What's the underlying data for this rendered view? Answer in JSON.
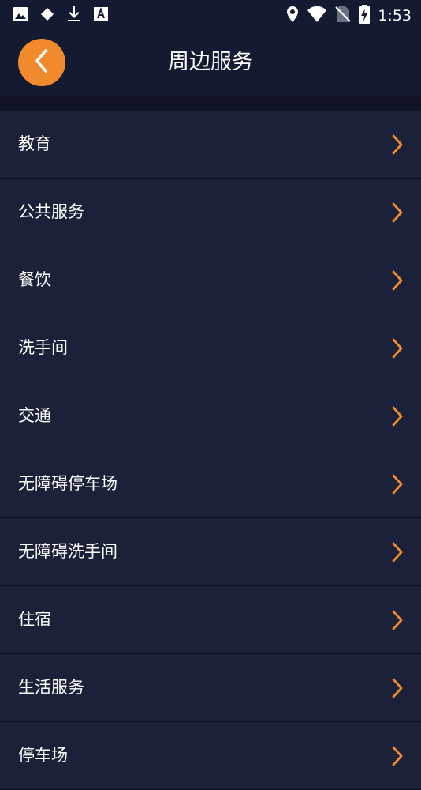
{
  "status_bar": {
    "time": "1:53",
    "icons": [
      "image-icon",
      "diamond-icon",
      "download-icon",
      "text-a-icon",
      "location-icon",
      "wifi-icon",
      "no-sim-icon",
      "battery-charging-icon"
    ]
  },
  "header": {
    "title": "周边服务",
    "back_icon": "chevron-left-icon"
  },
  "list": {
    "items": [
      {
        "label": "教育"
      },
      {
        "label": "公共服务"
      },
      {
        "label": "餐饮"
      },
      {
        "label": "洗手间"
      },
      {
        "label": "交通"
      },
      {
        "label": "无障碍停车场"
      },
      {
        "label": "无障碍洗手间"
      },
      {
        "label": "住宿"
      },
      {
        "label": "生活服务"
      },
      {
        "label": "停车场"
      }
    ]
  },
  "colors": {
    "accent": "#f08a2c",
    "background": "#151a2e",
    "header_bg": "#141a31",
    "row_bg": "#1b2139",
    "divider": "#0d1121"
  }
}
